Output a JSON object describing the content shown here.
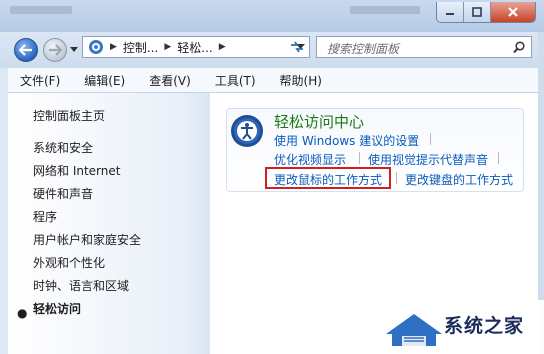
{
  "window": {
    "minimize": "minimize",
    "maximize": "maximize",
    "close": "close"
  },
  "navigation": {
    "breadcrumb": [
      "控制...",
      "轻松..."
    ],
    "search_placeholder": "搜索控制面板"
  },
  "menu": [
    "文件(F)",
    "编辑(E)",
    "查看(V)",
    "工具(T)",
    "帮助(H)"
  ],
  "sidebar": {
    "home": "控制面板主页",
    "items": [
      "系统和安全",
      "网络和 Internet",
      "硬件和声音",
      "程序",
      "用户帐户和家庭安全",
      "外观和个性化",
      "时钟、语言和区域",
      "轻松访问"
    ],
    "current_index": 7
  },
  "ease_center": {
    "title": "轻松访问中心",
    "links": {
      "windows_settings": "使用 Windows 建议的设置",
      "optimize_display": "优化视频显示",
      "visual_alternatives": "使用视觉提示代替声音",
      "mouse": "更改鼠标的工作方式",
      "keyboard": "更改键盘的工作方式"
    }
  },
  "watermark": {
    "text": "系统之家"
  },
  "colors": {
    "link": "#0a5bbd",
    "heading": "#1a7a14",
    "highlight_box": "#d11f1f"
  }
}
